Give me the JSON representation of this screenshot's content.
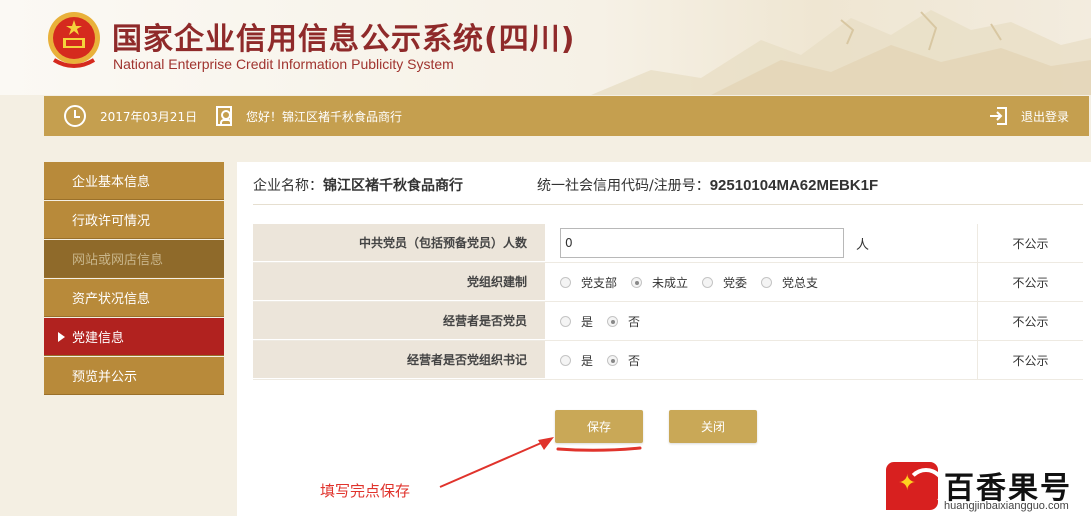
{
  "header": {
    "title_cn": "国家企业信用信息公示系统(四川)",
    "title_en": "National Enterprise Credit Information Publicity System"
  },
  "topbar": {
    "date": "2017年03月21日",
    "greeting": "您好！锦江区褚千秋食品商行",
    "logout_label": "退出登录"
  },
  "sidebar": {
    "items": [
      {
        "label": "企业基本信息",
        "state": "normal"
      },
      {
        "label": "行政许可情况",
        "state": "normal"
      },
      {
        "label": "网站或网店信息",
        "state": "disabled"
      },
      {
        "label": "资产状况信息",
        "state": "normal"
      },
      {
        "label": "党建信息",
        "state": "active"
      },
      {
        "label": "预览并公示",
        "state": "normal"
      }
    ]
  },
  "company": {
    "name_label": "企业名称：",
    "name_value": "锦江区褚千秋食品商行",
    "code_label": "统一社会信用代码/注册号：",
    "code_value": "92510104MA62MEBK1F"
  },
  "form": {
    "party_members": {
      "label": "中共党员（包括预备党员）人数",
      "value": "0",
      "unit": "人",
      "publicity": "不公示"
    },
    "party_org": {
      "label": "党组织建制",
      "options": [
        "党支部",
        "未成立",
        "党委",
        "党总支"
      ],
      "selected": "未成立",
      "publicity": "不公示"
    },
    "operator_member": {
      "label": "经营者是否党员",
      "options": [
        "是",
        "否"
      ],
      "selected": "否",
      "publicity": "不公示"
    },
    "operator_secretary": {
      "label": "经营者是否党组织书记",
      "options": [
        "是",
        "否"
      ],
      "selected": "否",
      "publicity": "不公示"
    }
  },
  "buttons": {
    "save": "保存",
    "close": "关闭"
  },
  "annotation": {
    "text": "填写完点保存",
    "color": "#e0332c"
  },
  "watermark": {
    "brand": "百香果号",
    "url": "huangjinbaixiangguo.com"
  },
  "colors": {
    "gold": "#c59f4f",
    "active_red": "#b1221f",
    "title_red": "#8f2a2a"
  }
}
